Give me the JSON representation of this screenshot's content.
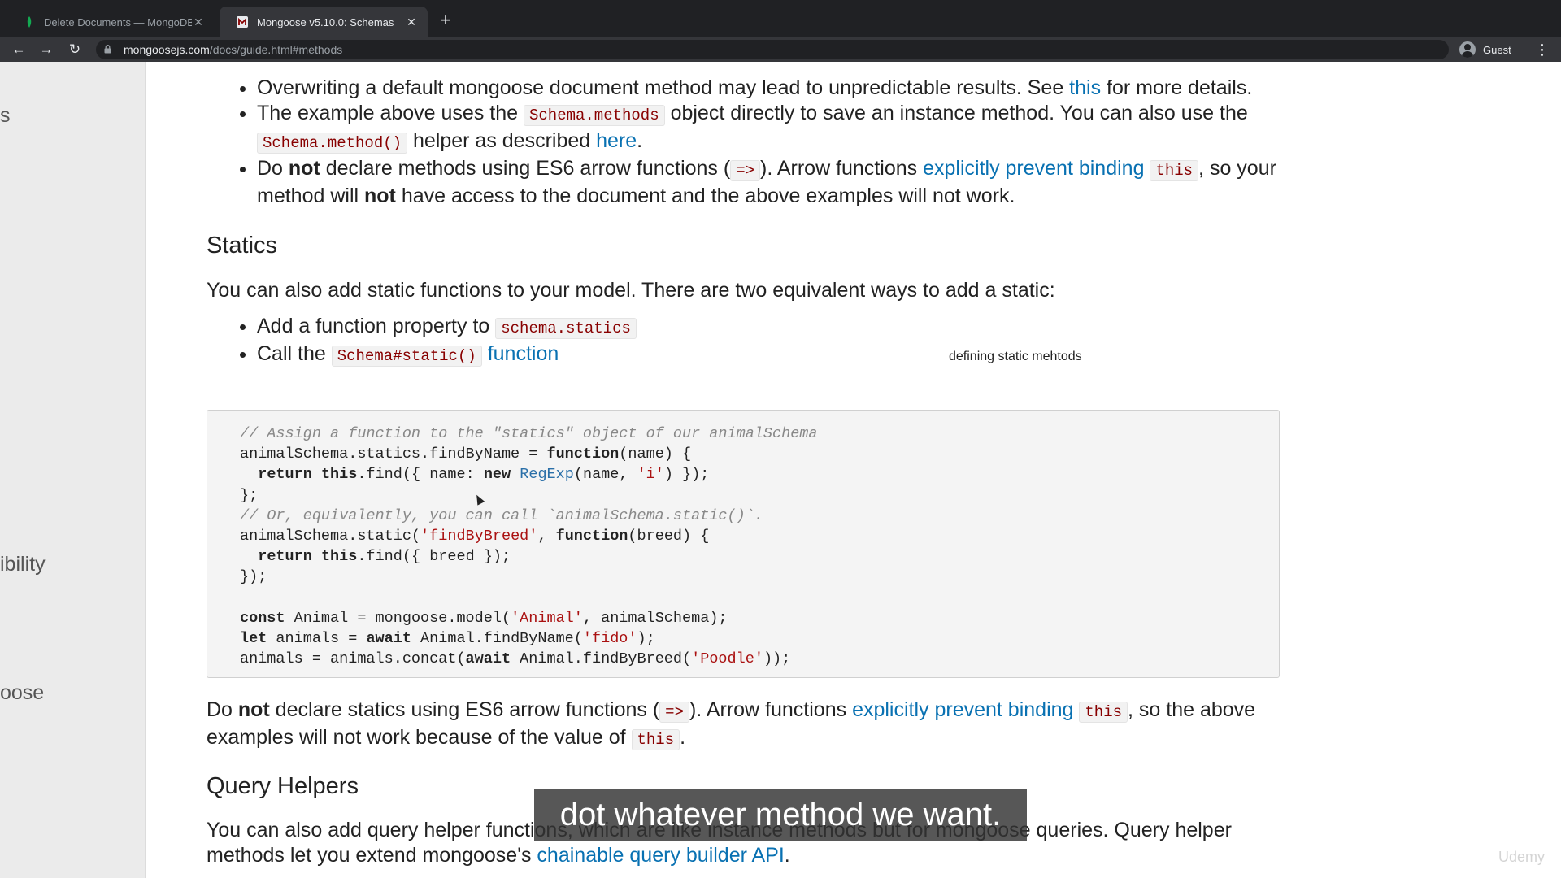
{
  "browser": {
    "tabs": [
      {
        "title": "Delete Documents — MongoDB",
        "active": false
      },
      {
        "title": "Mongoose v5.10.0: Schemas",
        "active": true
      }
    ],
    "url_host": "mongoosejs.com",
    "url_path": "/docs/guide.html#methods",
    "profile_label": "Guest"
  },
  "sidebar": {
    "fragments": [
      "s",
      "ibility",
      "oose"
    ]
  },
  "bullets_top": [
    {
      "pre": "Overwriting a default mongoose document method may lead to unpredictable results. See ",
      "link": "this",
      "post": " for more details."
    },
    {
      "pre": "The example above uses the ",
      "code1": "Schema.methods",
      "mid": " object directly to save an instance method. You can also use the ",
      "code2": "Schema.method()",
      "mid2": " helper as described ",
      "link": "here",
      "post": "."
    },
    {
      "pre": "Do ",
      "bold": "not",
      "mid": " declare methods using ES6 arrow functions (",
      "code1": "=>",
      "mid2": "). Arrow functions ",
      "link": "explicitly prevent binding",
      "code2": "this",
      "mid3": ", so your method will ",
      "bold2": "not",
      "post": " have access to the document and the above examples will not work."
    }
  ],
  "statics": {
    "heading": "Statics",
    "intro": "You can also add static functions to your model. There are two equivalent ways to add a static:",
    "item1_text": "Add a function property to ",
    "item1_code": "schema.statics",
    "item2_text": "Call the ",
    "item2_code": "Schema#static()",
    "item2_link": "function"
  },
  "annotation": "defining static mehtods",
  "code_lines": [
    "// Assign a function to the \"statics\" object of our animalSchema",
    "animalSchema.statics.findByName = function(name) {",
    "  return this.find({ name: new RegExp(name, 'i') });",
    "};",
    "// Or, equivalently, you can call `animalSchema.static()`.",
    "animalSchema.static('findByBreed', function(breed) {",
    "  return this.find({ breed });",
    "});",
    "",
    "const Animal = mongoose.model('Animal', animalSchema);",
    "let animals = await Animal.findByName('fido');",
    "animals = animals.concat(await Animal.findByBreed('Poodle'));"
  ],
  "after_code": {
    "pre": "Do ",
    "bold": "not",
    "mid": " declare statics using ES6 arrow functions (",
    "code1": "=>",
    "mid2": "). Arrow functions ",
    "link": "explicitly prevent binding",
    "code2": "this",
    "mid3": ", so the above examples will not work because of the value of ",
    "code3": "this",
    "post": "."
  },
  "query_helpers": {
    "heading": "Query Helpers",
    "pre": "You can also add query helper functions, which are like instance methods but for mongoose queries. Query helper methods let you extend mongoose's ",
    "link": "chainable query builder API",
    "post": "."
  },
  "caption": "dot whatever method we want.",
  "watermark": "Udemy"
}
